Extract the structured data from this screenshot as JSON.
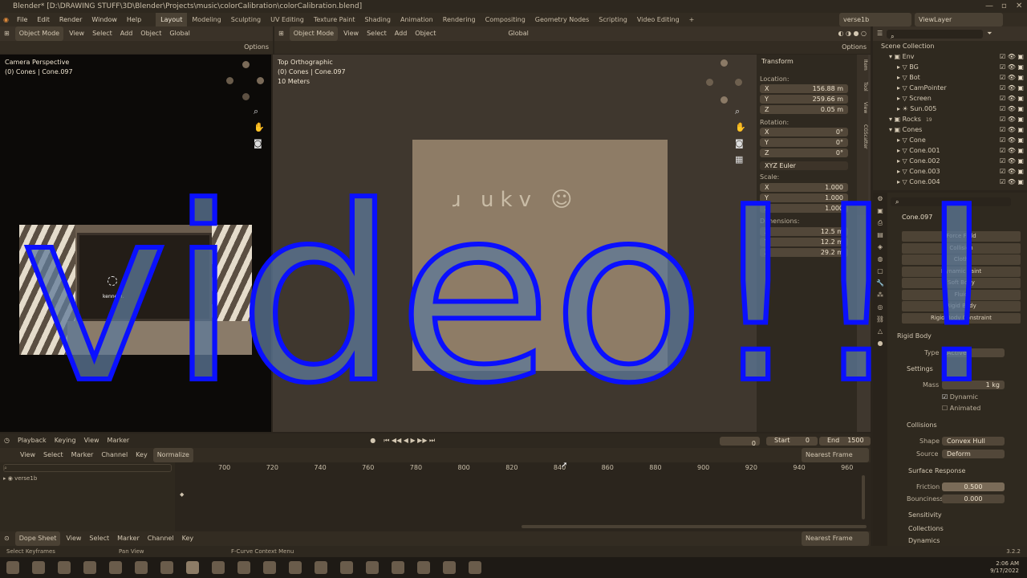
{
  "window": {
    "title": "Blender* [D:\\DRAWING STUFF\\3D\\Blender\\Projects\\music\\colorCalibration\\colorCalibration.blend]"
  },
  "menubar": {
    "file_menu": [
      "File",
      "Edit",
      "Render",
      "Window",
      "Help"
    ],
    "workspaces": [
      "Layout",
      "Modeling",
      "Sculpting",
      "UV Editing",
      "Texture Paint",
      "Shading",
      "Animation",
      "Rendering",
      "Compositing",
      "Geometry Nodes",
      "Scripting",
      "Video Editing"
    ],
    "active_workspace": "Layout",
    "add_tab": "+",
    "scene": "verse1b",
    "view_layer": "ViewLayer"
  },
  "camera_viewport": {
    "mode": "Object Mode",
    "menus": [
      "View",
      "Select",
      "Add",
      "Object"
    ],
    "transform": "Global",
    "options": "Options",
    "label_view": "Camera Perspective",
    "label_object": "(0) Cones | Cone.097",
    "sign_text": "kenneth."
  },
  "top_viewport": {
    "mode": "Object Mode",
    "menus": [
      "View",
      "Select",
      "Add",
      "Object"
    ],
    "transform": "Global",
    "options": "Options",
    "label_view": "Top Orthographic",
    "label_object": "(0) Cones | Cone.097",
    "label_scale": "10 Meters",
    "canvas_text": "ɹ ukv ☺"
  },
  "npanel": {
    "title": "Transform",
    "tabs": [
      "Item",
      "Tool",
      "View",
      "CGScatter"
    ],
    "location_label": "Location:",
    "location": [
      {
        "axis": "X",
        "value": "156.88 m"
      },
      {
        "axis": "Y",
        "value": "259.66 m"
      },
      {
        "axis": "Z",
        "value": "0.05 m"
      }
    ],
    "rotation_label": "Rotation:",
    "rotation": [
      {
        "axis": "X",
        "value": "0°"
      },
      {
        "axis": "Y",
        "value": "0°"
      },
      {
        "axis": "Z",
        "value": "0°"
      }
    ],
    "rotation_mode": "XYZ Euler",
    "scale_label": "Scale:",
    "scale": [
      {
        "axis": "X",
        "value": "1.000"
      },
      {
        "axis": "Y",
        "value": "1.000"
      },
      {
        "axis": "Z",
        "value": "1.000"
      }
    ],
    "dimensions_label": "Dimensions:",
    "dimensions": [
      {
        "axis": "X",
        "value": "12.5 m"
      },
      {
        "axis": "Y",
        "value": "12.2 m"
      },
      {
        "axis": "Z",
        "value": "29.2 m"
      }
    ]
  },
  "outliner": {
    "root": "Scene Collection",
    "rows": [
      {
        "name": "Env",
        "indent": 1,
        "type": "collection"
      },
      {
        "name": "BG",
        "indent": 2,
        "type": "object"
      },
      {
        "name": "Bot",
        "indent": 2,
        "type": "object"
      },
      {
        "name": "CamPointer",
        "indent": 2,
        "type": "object"
      },
      {
        "name": "Screen",
        "indent": 2,
        "type": "object"
      },
      {
        "name": "Sun.005",
        "indent": 2,
        "type": "light"
      },
      {
        "name": "Rocks",
        "indent": 1,
        "type": "collection",
        "badge": "19"
      },
      {
        "name": "Cones",
        "indent": 1,
        "type": "collection"
      },
      {
        "name": "Cone",
        "indent": 2,
        "type": "object"
      },
      {
        "name": "Cone.001",
        "indent": 2,
        "type": "object"
      },
      {
        "name": "Cone.002",
        "indent": 2,
        "type": "object"
      },
      {
        "name": "Cone.003",
        "indent": 2,
        "type": "object"
      },
      {
        "name": "Cone.004",
        "indent": 2,
        "type": "object"
      }
    ]
  },
  "properties": {
    "object_name": "Cone.097",
    "physics_buttons": [
      "Force Field",
      "Collision",
      "Cloth",
      "Dynamic Paint",
      "Soft Body",
      "Fluid",
      "Rigid Body",
      "Rigid Body Constraint"
    ],
    "rigid_body_header": "Rigid Body",
    "type_label": "Type",
    "type_value": "Active",
    "settings_header": "Settings",
    "mass_label": "Mass",
    "mass_value": "1 kg",
    "dynamic_label": "Dynamic",
    "animated_label": "Animated",
    "collisions_header": "Collisions",
    "shape_label": "Shape",
    "shape_value": "Convex Hull",
    "source_label": "Source",
    "source_value": "Deform",
    "surface_header": "Surface Response",
    "friction_label": "Friction",
    "friction_value": "0.500",
    "bounciness_label": "Bounciness",
    "bounciness_value": "0.000",
    "sensitivity_header": "Sensitivity",
    "collections_header": "Collections",
    "dynamics_header": "Dynamics"
  },
  "timeline": {
    "menus": [
      "Playback",
      "Keying",
      "View",
      "Marker"
    ],
    "current_frame": "0",
    "start_label": "Start",
    "start": "0",
    "end_label": "End",
    "end": "1500"
  },
  "dopesheet": {
    "menus": [
      "View",
      "Select",
      "Marker",
      "Channel",
      "Key"
    ],
    "normalize": "Normalize",
    "ticks": [
      "700",
      "720",
      "740",
      "760",
      "780",
      "800",
      "820",
      "840",
      "860",
      "880",
      "900",
      "920",
      "940",
      "960"
    ],
    "channel": "verse1b",
    "snap": "Nearest Frame",
    "footer_mode": "Dope Sheet",
    "footer_menus": [
      "View",
      "Select",
      "Marker",
      "Channel",
      "Key"
    ],
    "footer_snap": "Nearest Frame"
  },
  "statusbar": {
    "left": "Select Keyframes",
    "middle": "Pan View",
    "right": "F-Curve Context Menu",
    "version": "3.2.2"
  },
  "taskbar": {
    "time": "2:06 AM",
    "date": "9/17/2022"
  },
  "overlay": {
    "text": "video!!!"
  },
  "colors": {
    "overlay_fill": "#5e7a9a",
    "overlay_stroke": "#0a10ff",
    "accent": "#4b4235"
  }
}
